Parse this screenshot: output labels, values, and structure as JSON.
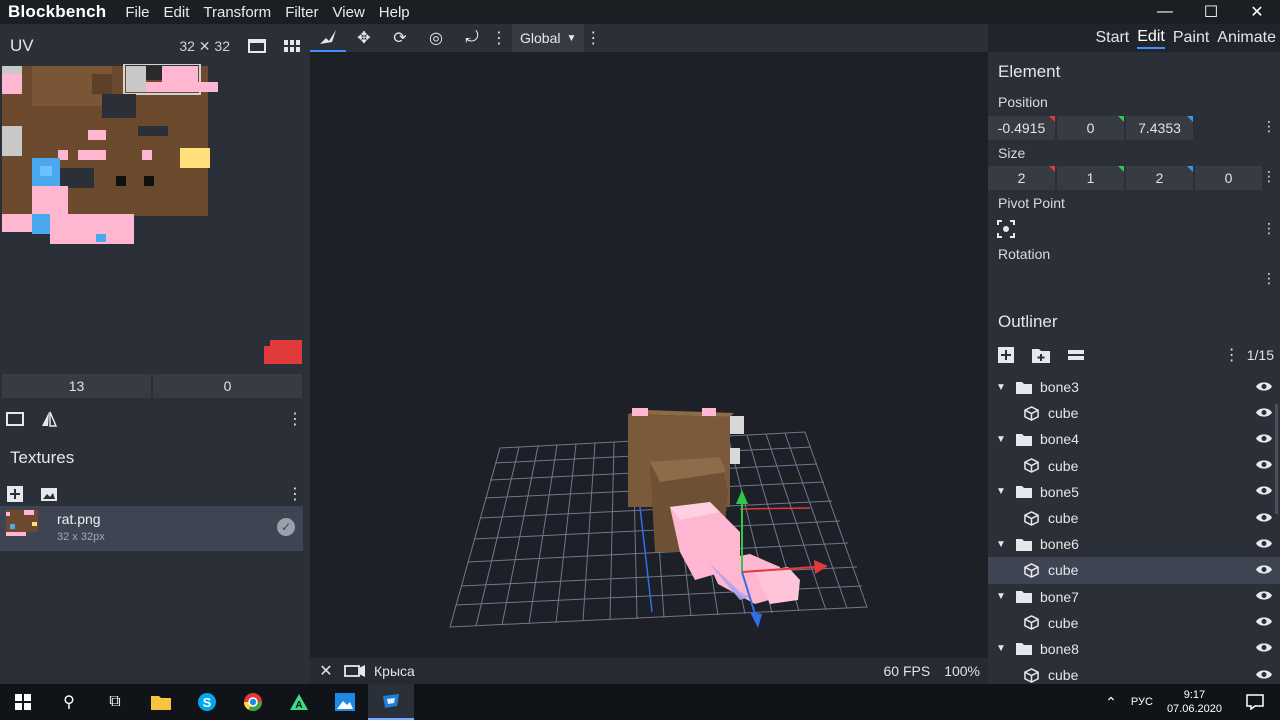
{
  "app": {
    "brand": "Blockbench",
    "menu": [
      "File",
      "Edit",
      "Transform",
      "Filter",
      "View",
      "Help"
    ],
    "window_controls": [
      "—",
      "☐",
      "✕"
    ]
  },
  "uv": {
    "title": "UV",
    "size": "32 ✕ 32",
    "fields": [
      "13",
      "0"
    ]
  },
  "textures": {
    "title": "Textures",
    "item": {
      "name": "rat.png",
      "dims": "32 x 32px"
    }
  },
  "toolbar": {
    "space_select": "Global"
  },
  "modes": [
    {
      "label": "Start",
      "active": false
    },
    {
      "label": "Edit",
      "active": true
    },
    {
      "label": "Paint",
      "active": false
    },
    {
      "label": "Animate",
      "active": false
    }
  ],
  "element": {
    "title": "Element",
    "position_label": "Position",
    "position": [
      "-0.4915",
      "0",
      "7.4353"
    ],
    "size_label": "Size",
    "size": [
      "2",
      "1",
      "2",
      "0"
    ],
    "pivot_label": "Pivot Point",
    "rotation_label": "Rotation"
  },
  "outliner": {
    "title": "Outliner",
    "count": "1/15",
    "rows": [
      {
        "type": "group",
        "label": "bone3"
      },
      {
        "type": "cube",
        "label": "cube"
      },
      {
        "type": "group",
        "label": "bone4"
      },
      {
        "type": "cube",
        "label": "cube"
      },
      {
        "type": "group",
        "label": "bone5"
      },
      {
        "type": "cube",
        "label": "cube"
      },
      {
        "type": "group",
        "label": "bone6"
      },
      {
        "type": "cube",
        "label": "cube",
        "selected": true
      },
      {
        "type": "group",
        "label": "bone7"
      },
      {
        "type": "cube",
        "label": "cube"
      },
      {
        "type": "group",
        "label": "bone8"
      },
      {
        "type": "cube",
        "label": "cube"
      }
    ]
  },
  "viewport": {
    "tab_name": "Крыса",
    "fps": "60 FPS",
    "zoom": "100%"
  },
  "taskbar": {
    "lang": "РУС",
    "time": "9:17",
    "date": "07.06.2020"
  },
  "colors": {
    "accent": "#3e90ff",
    "panel": "#2b2f37",
    "viewport": "#1d2026",
    "axis_x": "#e23a3a",
    "axis_y": "#2ec94a",
    "axis_z": "#2f6fe8",
    "rat_brown": "#7a5a3a",
    "rat_pink": "#ffb6d1"
  }
}
